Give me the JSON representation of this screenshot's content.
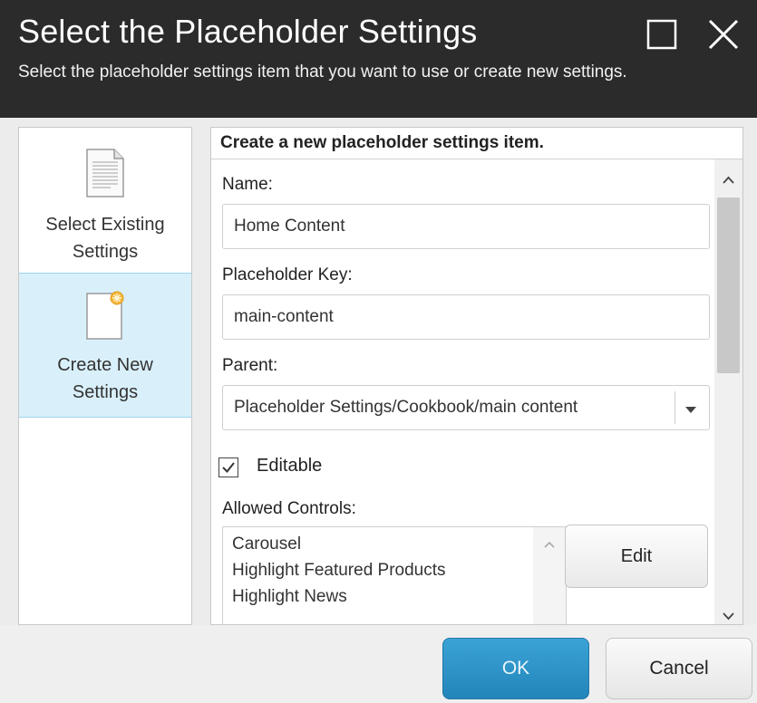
{
  "dialog": {
    "title": "Select the Placeholder Settings",
    "description": "Select the placeholder settings item that you want to use or create new settings."
  },
  "nav": {
    "items": [
      {
        "label": "Select Existing\nSettings",
        "icon": "document-icon",
        "selected": false
      },
      {
        "label": "Create New\nSettings",
        "icon": "new-document-icon",
        "selected": true
      }
    ]
  },
  "form": {
    "heading": "Create a new placeholder settings item.",
    "name_label": "Name:",
    "name_value": "Home Content",
    "key_label": "Placeholder Key:",
    "key_value": "main-content",
    "parent_label": "Parent:",
    "parent_value": "Placeholder Settings/Cookbook/main content",
    "editable_label": "Editable",
    "editable_checked": true,
    "allowed_label": "Allowed Controls:",
    "allowed_controls": [
      "Carousel",
      "Highlight Featured Products",
      "Highlight News"
    ],
    "edit_label": "Edit"
  },
  "footer": {
    "ok_label": "OK",
    "cancel_label": "Cancel"
  },
  "colors": {
    "header_bg": "#2b2b2b",
    "selected_nav_bg": "#d9f0fb",
    "primary_button": "#2a8fc4"
  }
}
